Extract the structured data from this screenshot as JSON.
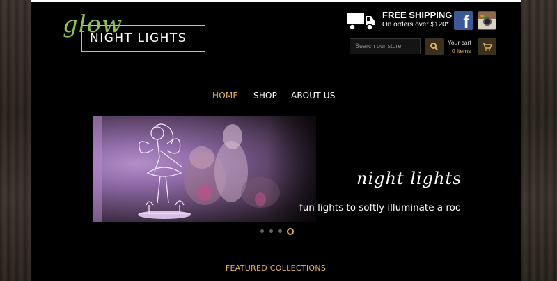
{
  "logo": {
    "script_text": "glow",
    "main_text": "NIGHT LIGHTS",
    "accent_color": "#8fc04b"
  },
  "shipping": {
    "title": "FREE SHIPPING",
    "subtitle": "On orders over $120*"
  },
  "social": {
    "facebook_letter": "f",
    "facebook_icon": "facebook-icon",
    "instagram_icon": "instagram-icon"
  },
  "search": {
    "placeholder": "Search our store"
  },
  "cart": {
    "label": "Your cart",
    "count": "0 items"
  },
  "nav": {
    "items": [
      {
        "label": "HOME",
        "active": true
      },
      {
        "label": "SHOP",
        "active": false
      },
      {
        "label": "ABOUT US",
        "active": false
      }
    ]
  },
  "slideshow": {
    "title": "night lights",
    "subtitle": "fun lights to softly illuminate a room",
    "slide_count": 4,
    "active_slide": 4
  },
  "featured": {
    "heading": "FEATURED COLLECTIONS"
  },
  "colors": {
    "accent": "#e3b15c",
    "background": "#000000",
    "brand_green": "#8fc04b"
  }
}
